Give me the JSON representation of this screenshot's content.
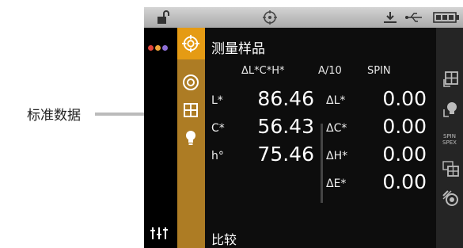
{
  "annotation": {
    "label": "标准数据"
  },
  "statusbar": {
    "icons": [
      "unlock-icon",
      "target-icon",
      "download-icon",
      "usb-icon",
      "battery-icon"
    ]
  },
  "leftbar": {
    "dots_colors": [
      "#e0443c",
      "#f0a63a",
      "#8d6fd6"
    ]
  },
  "tabs": [
    "target-icon",
    "aperture-icon",
    "grid-icon",
    "bulb-icon"
  ],
  "screen": {
    "title": "测量样品",
    "header": {
      "space": "ΔL*C*H*",
      "illuminant": "A/10",
      "mode": "SPIN"
    },
    "rows": [
      {
        "label": "L*",
        "value": "86.46",
        "delta_label": "ΔL*",
        "delta_value": "0.00"
      },
      {
        "label": "C*",
        "value": "56.43",
        "delta_label": "ΔC*",
        "delta_value": "0.00"
      },
      {
        "label": "h°",
        "value": "75.46",
        "delta_label": "ΔH*",
        "delta_value": "0.00"
      },
      {
        "label": "",
        "value": "",
        "delta_label": "ΔE*",
        "delta_value": "0.00"
      }
    ],
    "footer": "比较"
  },
  "rightbar": {
    "spin_label": "SPIN",
    "spex_label": "SPEX"
  },
  "colors": {
    "accent": "#e59b14",
    "tabbar": "#ad7c24",
    "screen_bg": "#0d0d0d"
  }
}
